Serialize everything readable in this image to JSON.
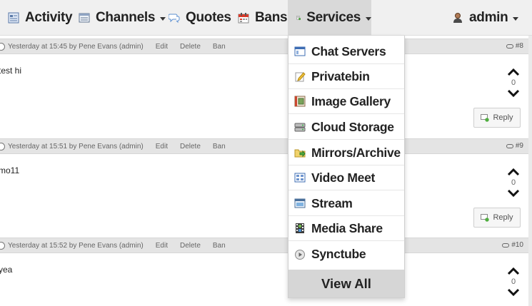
{
  "nav": {
    "activity": "Activity",
    "channels": "Channels",
    "quotes": "Quotes",
    "bans": "Bans",
    "services": "Services",
    "user": "admin"
  },
  "services_menu": {
    "items": [
      {
        "label": "Chat Servers",
        "icon": "chat-servers-icon"
      },
      {
        "label": "Privatebin",
        "icon": "pencil-note-icon"
      },
      {
        "label": "Image Gallery",
        "icon": "image-gallery-icon"
      },
      {
        "label": "Cloud Storage",
        "icon": "storage-drive-icon"
      },
      {
        "label": "Mirrors/Archive",
        "icon": "folder-arrow-icon"
      },
      {
        "label": "Video Meet",
        "icon": "video-grid-icon"
      },
      {
        "label": "Stream",
        "icon": "stream-window-icon"
      },
      {
        "label": "Media Share",
        "icon": "film-icon"
      },
      {
        "label": "Synctube",
        "icon": "play-circle-icon"
      }
    ],
    "view_all": "View All"
  },
  "posts": [
    {
      "meta": "Yesterday at 15:45 by Pene Evans (admin)",
      "edit": "Edit",
      "delete": "Delete",
      "ban": "Ban",
      "number": "#8",
      "body": "test hi",
      "votes": "0",
      "reply": "Reply"
    },
    {
      "meta": "Yesterday at 15:51 by Pene Evans (admin)",
      "edit": "Edit",
      "delete": "Delete",
      "ban": "Ban",
      "number": "#9",
      "body": "mo11",
      "votes": "0",
      "reply": "Reply"
    },
    {
      "meta": "Yesterday at 15:52 by Pene Evans (admin)",
      "edit": "Edit",
      "delete": "Delete",
      "ban": "Ban",
      "number": "#10",
      "body": "yea",
      "votes": "0",
      "reply": "Reply"
    }
  ]
}
